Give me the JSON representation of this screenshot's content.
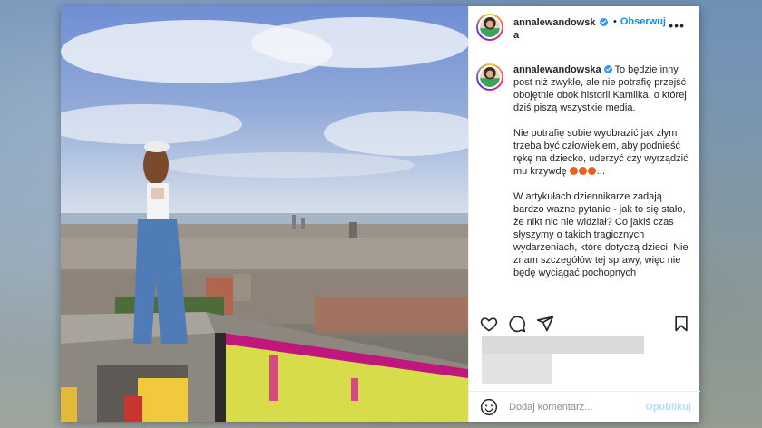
{
  "post": {
    "username": "annalewandowska",
    "follow_separator": "•",
    "follow_label": "Obserwuj",
    "more_icon": "more-options-icon",
    "verified_icon": "verified-badge-icon",
    "photo_description_icon": "photo"
  },
  "caption": {
    "username": "annalewandowska",
    "paragraph1": "To będzie inny post niż zwykle, ale nie potrafię przejść obojętnie obok historii Kamilka, o której dziś piszą wszystkie media.",
    "paragraph2": "Nie potrafię sobie wyobrazić jak złym trzeba być człowiekiem, aby podnieść rękę na dziecko, uderzyć czy wyrządzić mu krzywdę",
    "paragraph2_suffix": "...",
    "paragraph3": "W artykułach dziennikarze zadają bardzo ważne pytanie - jak to się stało, że nikt nic nie widział? Co jakiś czas słyszymy o takich tragicznych wydarzeniach, które dotyczą dzieci. Nie znam szczegółów tej sprawy, więc nie będę wyciągać pochopnych"
  },
  "actions": {
    "like_icon": "heart-icon",
    "comment_icon": "comment-icon",
    "share_icon": "share-icon",
    "save_icon": "bookmark-icon"
  },
  "comment_box": {
    "emoji_icon": "smile-icon",
    "placeholder": "Dodaj komentarz...",
    "publish_label": "Opublikuj"
  },
  "colors": {
    "accent": "#0095f6",
    "publish_disabled": "#b2dffc",
    "verified": "#3897f0"
  }
}
